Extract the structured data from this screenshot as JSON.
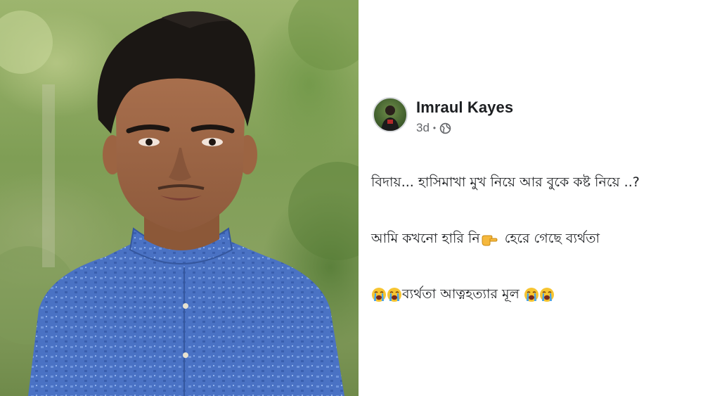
{
  "photo": {
    "subject_icon": "person-portrait"
  },
  "post": {
    "author_name": "Imraul Kayes",
    "timestamp": "3d",
    "separator": "•",
    "audience_icon": "globe-icon",
    "lines": [
      {
        "text": "বিদায়... হাসিমাখা মুখ নিয়ে আর বুকে কষ্ট নিয়ে ..?"
      },
      {
        "before": "আমি কখনো হারি নি",
        "emoji": "pointing-right-emoji",
        "after": " হেরে গেছে ব্যর্থতা"
      },
      {
        "emoji": "loudly-crying-face-emoji",
        "text": "ব্যর্থতা আত্নহত্যার মূল"
      }
    ]
  },
  "colors": {
    "name": "#1c1e21",
    "meta": "#65676b",
    "shirt": "#4a72c4"
  }
}
